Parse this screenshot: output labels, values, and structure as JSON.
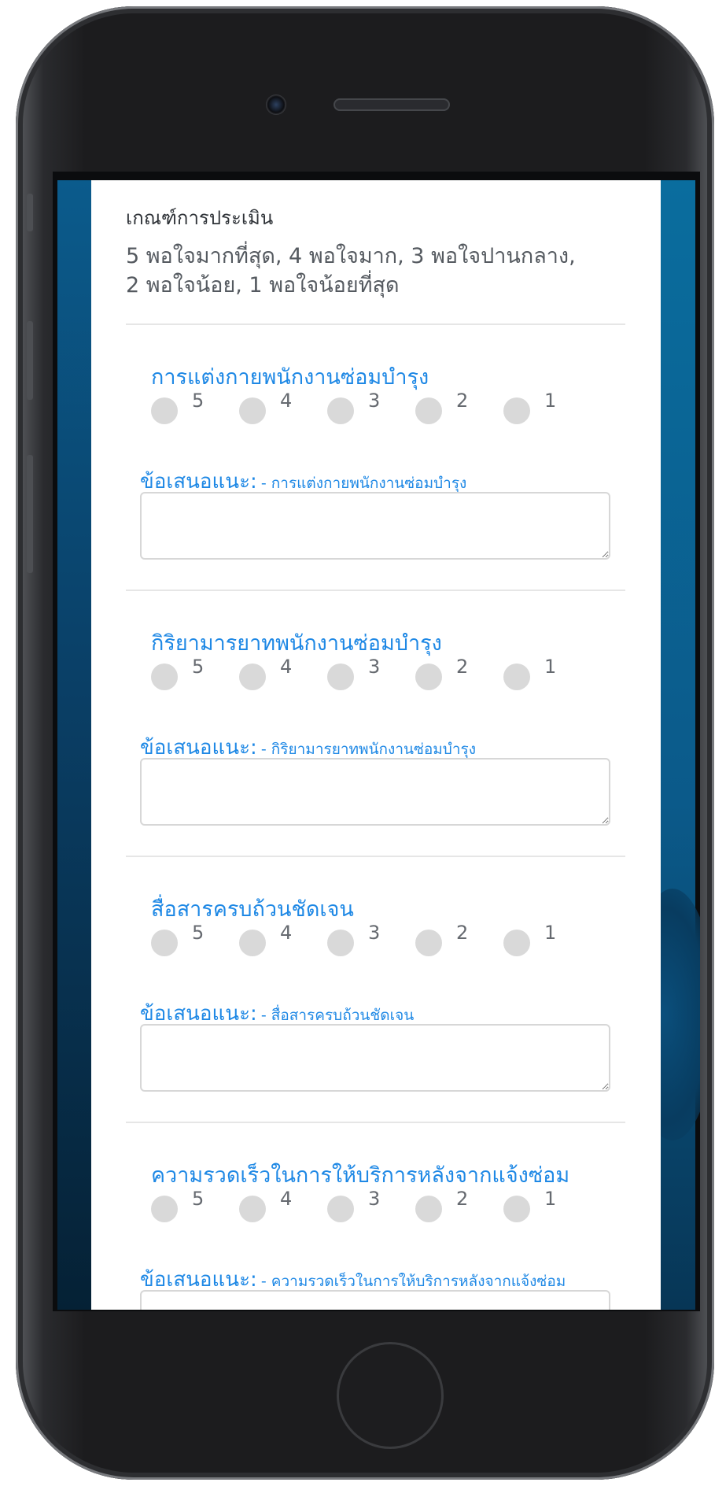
{
  "form": {
    "criteria_heading": "เกณฑ์การประเมิน",
    "criteria_line1": "5 พอใจมากที่สุด, 4 พอใจมาก, 3 พอใจปานกลาง,",
    "criteria_line2": "2 พอใจน้อย, 1 พอใจน้อยที่สุด",
    "rating_options": [
      "5",
      "4",
      "3",
      "2",
      "1"
    ],
    "suggestion_label": "ข้อเสนอแนะ:",
    "questions": [
      {
        "title": "การแต่งกายพนักงานซ่อมบำรุง",
        "suggestion_suffix": "- การแต่งกายพนักงานซ่อมบำรุง",
        "suggestion_value": ""
      },
      {
        "title": "กิริยามารยาทพนักงานซ่อมบำรุง",
        "suggestion_suffix": "- กิริยามารยาทพนักงานซ่อมบำรุง",
        "suggestion_value": ""
      },
      {
        "title": "สื่อสารครบถ้วนชัดเจน",
        "suggestion_suffix": "- สื่อสารครบถ้วนชัดเจน",
        "suggestion_value": ""
      },
      {
        "title": "ความรวดเร็วในการให้บริการหลังจากแจ้งซ่อม",
        "suggestion_suffix": "- ความรวดเร็วในการให้บริการหลังจากแจ้งซ่อม",
        "suggestion_value": ""
      }
    ]
  }
}
